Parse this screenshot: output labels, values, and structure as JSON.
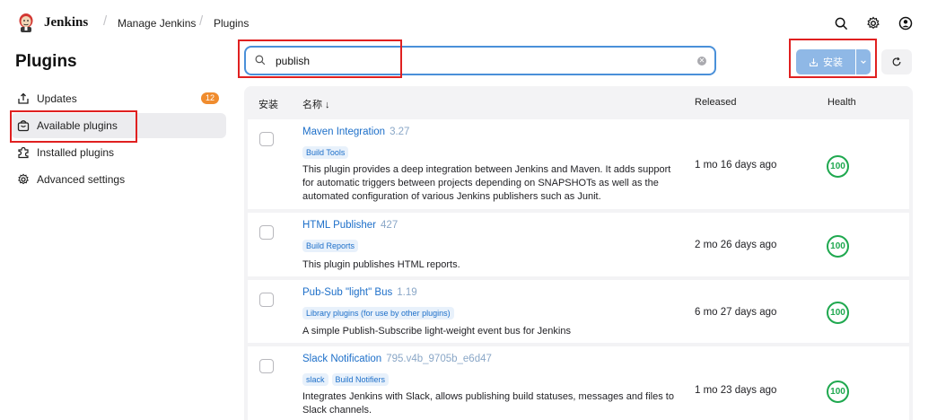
{
  "header": {
    "brand": "Jenkins",
    "breadcrumbs": [
      "Manage Jenkins",
      "Plugins"
    ],
    "icons": [
      "search-icon",
      "gear-icon",
      "user-icon"
    ]
  },
  "sidebar": {
    "title": "Plugins",
    "items": [
      {
        "label": "Updates",
        "icon": "update-icon",
        "badge": "12"
      },
      {
        "label": "Available plugins",
        "icon": "bag-icon",
        "active": true
      },
      {
        "label": "Installed plugins",
        "icon": "puzzle-icon"
      },
      {
        "label": "Advanced settings",
        "icon": "gear-icon"
      }
    ]
  },
  "search": {
    "value": "publish"
  },
  "toolbar": {
    "install_label": "安装"
  },
  "table": {
    "headers": {
      "install": "安装",
      "name": "名称 ↓",
      "released": "Released",
      "health": "Health"
    },
    "rows": [
      {
        "name": "Maven Integration",
        "version": "3.27",
        "tags": [
          "Build Tools"
        ],
        "description": "This plugin provides a deep integration between Jenkins and Maven. It adds support for automatic triggers between projects depending on SNAPSHOTs as well as the automated configuration of various Jenkins publishers such as Junit.",
        "released": "1 mo 16 days ago",
        "health": "100"
      },
      {
        "name": "HTML Publisher",
        "version": "427",
        "tags": [
          "Build Reports"
        ],
        "description": "This plugin publishes HTML reports.",
        "released": "2 mo 26 days ago",
        "health": "100"
      },
      {
        "name": "Pub-Sub \"light\" Bus",
        "version": "1.19",
        "tags": [
          "Library plugins (for use by other plugins)"
        ],
        "description": "A simple Publish-Subscribe light-weight event bus for Jenkins",
        "released": "6 mo 27 days ago",
        "health": "100"
      },
      {
        "name": "Slack Notification",
        "version": "795.v4b_9705b_e6d47",
        "tags": [
          "slack",
          "Build Notifiers"
        ],
        "description": "Integrates Jenkins with Slack, allows publishing build statuses, messages and files to Slack channels.",
        "released": "1 mo 23 days ago",
        "health": "100"
      }
    ]
  },
  "colors": {
    "accent": "#1d6fc9",
    "install_button": "#8fb8e6",
    "badge": "#f08c2e",
    "health": "#1fa84f",
    "highlight": "#e02020"
  }
}
